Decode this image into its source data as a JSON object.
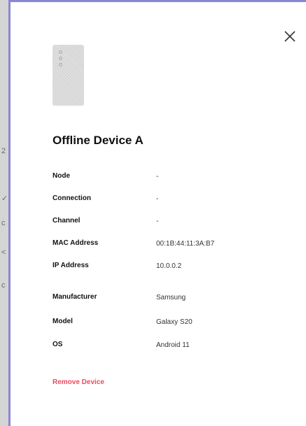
{
  "modal": {
    "title": "Offline Device A",
    "close_icon": "close-icon",
    "thumbnail_icon": "phone-icon",
    "accent_color": "#8b86d4",
    "properties": [
      {
        "label": "Node",
        "value": "-"
      },
      {
        "label": "Connection",
        "value": "-"
      },
      {
        "label": "Channel",
        "value": "-"
      },
      {
        "label": "MAC Address",
        "value": "00:1B:44:11:3A:B7"
      },
      {
        "label": "IP Address",
        "value": "10.0.0.2"
      },
      {
        "label": "Manufacturer",
        "value": "Samsung"
      },
      {
        "label": "Model",
        "value": "Galaxy S20"
      },
      {
        "label": "OS",
        "value": "Android 11"
      }
    ],
    "remove_label": "Remove Device",
    "remove_color": "#ee4a5d"
  },
  "backdrop": {
    "glyphs": [
      "2",
      "✓",
      "c",
      "<",
      "c"
    ]
  }
}
